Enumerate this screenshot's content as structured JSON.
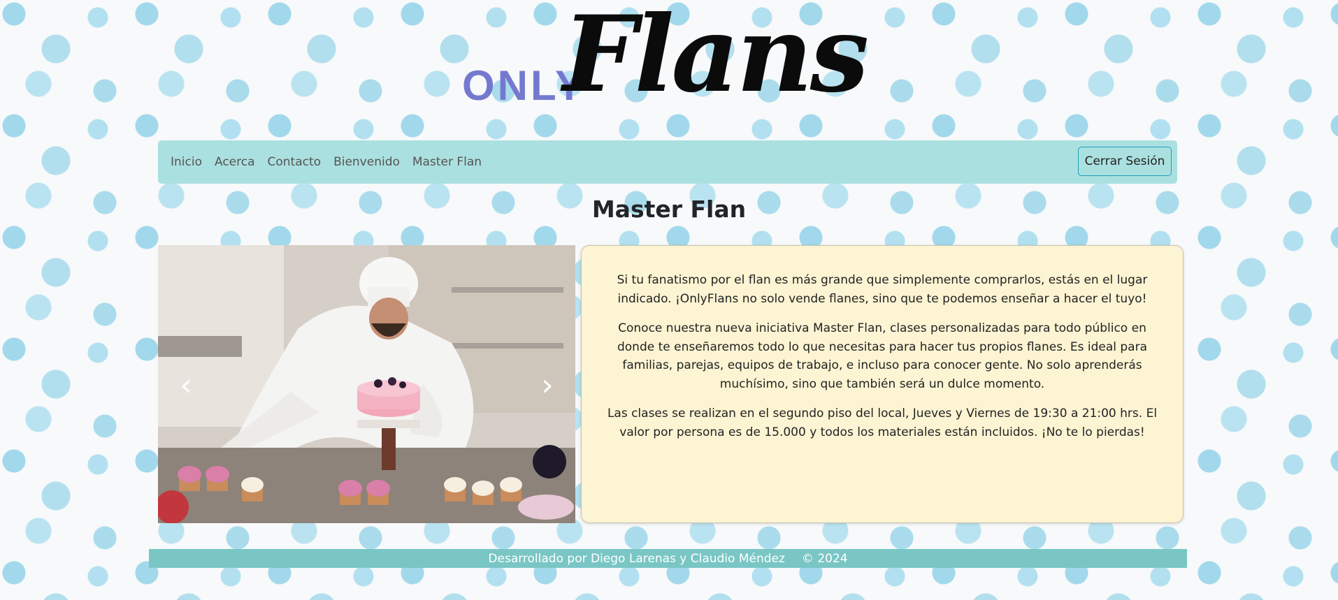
{
  "brand": {
    "logo_only": "ONLY",
    "logo_flans": "Flans",
    "only_color": "#7479cf"
  },
  "nav": {
    "links": [
      "Inicio",
      "Acerca",
      "Contacto",
      "Bienvenido",
      "Master Flan"
    ],
    "logout_label": "Cerrar Sesión"
  },
  "main": {
    "title": "Master Flan",
    "carousel": {
      "image_alt": "chef-decorating-cake-photo",
      "prev_icon": "‹",
      "next_icon": "›"
    },
    "paragraphs": [
      "Si tu fanatismo por el flan es más grande que simplemente comprarlos, estás en el lugar indicado. ¡OnlyFlans no solo vende flanes, sino que te podemos enseñar a hacer el tuyo!",
      "Conoce nuestra nueva iniciativa Master Flan, clases personalizadas para todo público en donde te enseñaremos todo lo que necesitas para hacer tus propios flanes. Es ideal para familias, parejas, equipos de trabajo, e incluso para conocer gente. No solo aprenderás muchísimo, sino que también será un dulce momento.",
      "Las clases se realizan en el segundo piso del local, Jueves y Viernes de 19:30 a 21:00 hrs. El valor por persona es de 15.000 y todos los materiales están incluidos. ¡No te lo pierdas!"
    ]
  },
  "footer": {
    "credits": "Desarrollado por Diego Larenas y Claudio Méndez",
    "copyright": "© 2024"
  },
  "colors": {
    "navbar": "#abe0e0",
    "footer": "#79c6c5",
    "card": "#fdf4d3"
  }
}
